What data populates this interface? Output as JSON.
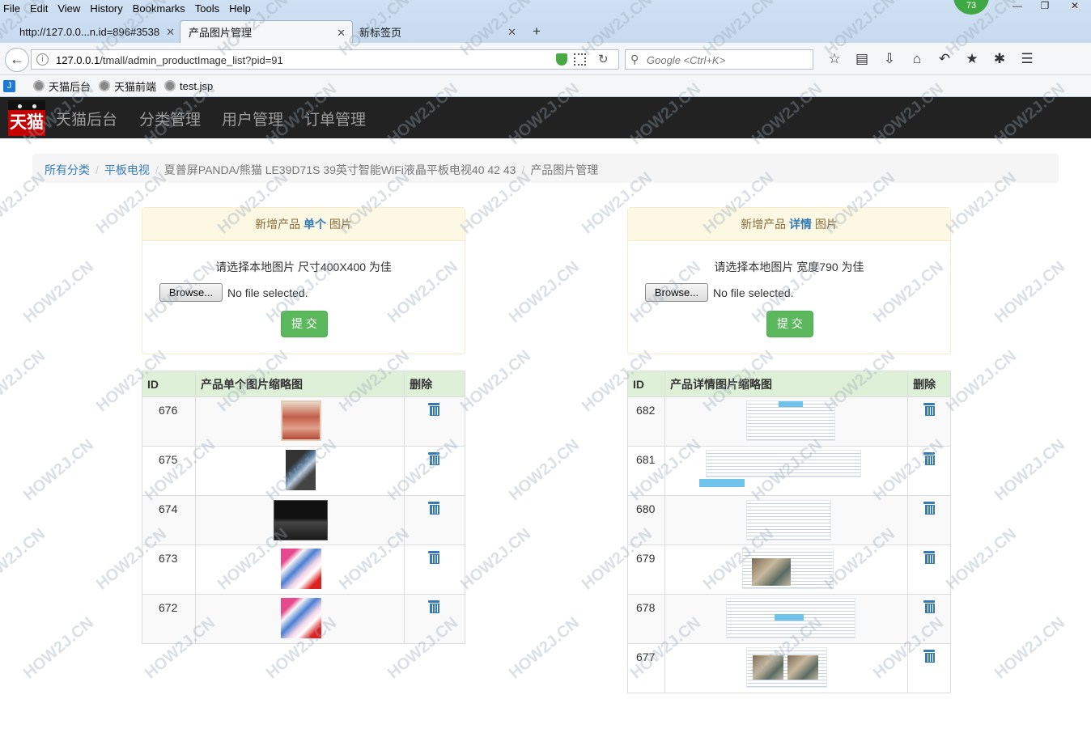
{
  "browser": {
    "menu": [
      "File",
      "Edit",
      "View",
      "History",
      "Bookmarks",
      "Tools",
      "Help"
    ],
    "badge": "73",
    "tabs": [
      {
        "label": "http://127.0.0...n.id=896#3538"
      },
      {
        "label": "产品图片管理"
      },
      {
        "label": "新标签页"
      }
    ],
    "url_host": "127.0.0.1",
    "url_path": "/tmall/admin_productImage_list?pid=91",
    "search_placeholder": "Google <Ctrl+K>",
    "bookmarks": [
      "天猫后台",
      "天猫前端",
      "test.jsp"
    ]
  },
  "app": {
    "logo_text": "天猫",
    "nav": [
      "天猫后台",
      "分类管理",
      "用户管理",
      "订单管理"
    ]
  },
  "breadcrumb": {
    "items": [
      "所有分类",
      "平板电视",
      "夏普屏PANDA/熊猫 LE39D71S 39英寸智能WiFi液晶平板电视40 42 43"
    ],
    "active": "产品图片管理"
  },
  "single_panel": {
    "title_prefix": "新增产品",
    "title_em": "单个",
    "title_suffix": "图片",
    "hint": "请选择本地图片 尺寸400X400 为佳",
    "browse_label": "Browse...",
    "file_status": "No file selected.",
    "submit_label": "提 交"
  },
  "detail_panel": {
    "title_prefix": "新增产品",
    "title_em": "详情",
    "title_suffix": "图片",
    "hint": "请选择本地图片 宽度790 为佳",
    "browse_label": "Browse...",
    "file_status": "No file selected.",
    "submit_label": "提 交"
  },
  "single_table": {
    "headers": [
      "ID",
      "产品单个图片缩略图",
      "删除"
    ],
    "rows": [
      {
        "id": "676"
      },
      {
        "id": "675"
      },
      {
        "id": "674"
      },
      {
        "id": "673"
      },
      {
        "id": "672"
      }
    ]
  },
  "detail_table": {
    "headers": [
      "ID",
      "产品详情图片缩略图",
      "删除"
    ],
    "rows": [
      {
        "id": "682"
      },
      {
        "id": "681"
      },
      {
        "id": "680"
      },
      {
        "id": "679"
      },
      {
        "id": "678"
      },
      {
        "id": "677"
      }
    ]
  },
  "watermark": "HOW2J.CN",
  "colors": {
    "app_nav_bg": "#222222",
    "breadcrumb_link": "#337ab7",
    "panel_header_bg": "#fcf8e3",
    "table_header_bg": "#dff0d8",
    "submit_bg": "#5cb85c",
    "logo_red": "#c40000"
  }
}
